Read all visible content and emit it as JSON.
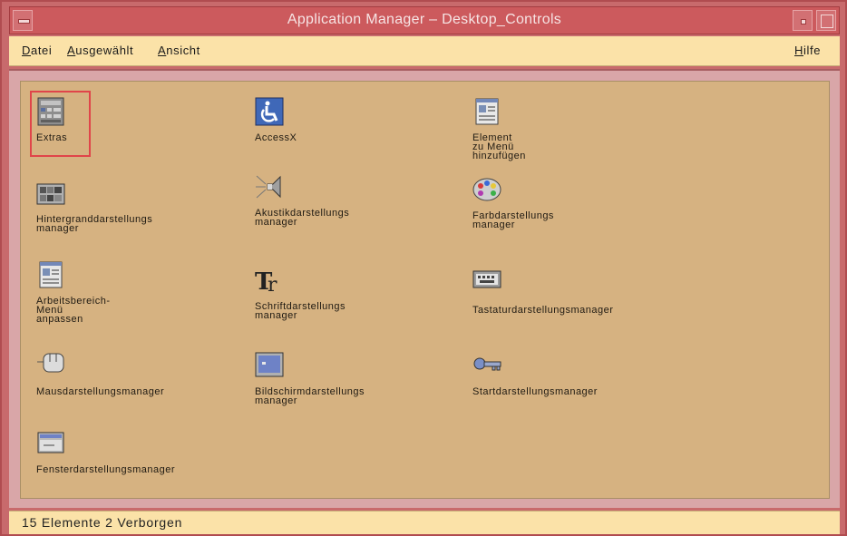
{
  "window": {
    "title": "Application Manager – Desktop_Controls"
  },
  "menubar": {
    "items": [
      {
        "mnemonic": "D",
        "rest": "atei"
      },
      {
        "mnemonic": "A",
        "rest": "usgewählt"
      },
      {
        "mnemonic": "A",
        "rest": "nsicht"
      }
    ],
    "help": {
      "mnemonic": "H",
      "rest": "ilfe"
    }
  },
  "icons": [
    {
      "label": "Extras",
      "icon": "tools-panel-icon",
      "selected": true
    },
    {
      "label": "AccessX",
      "icon": "accessibility-icon"
    },
    {
      "label": "Element zu Menü hinzufügen",
      "icon": "add-menu-item-icon"
    },
    {
      "label": "Hintergranddarstellungs\nmanager",
      "icon": "backdrop-icon"
    },
    {
      "label": "Akustikdarstellungs\nmanager",
      "icon": "speaker-icon"
    },
    {
      "label": "Farbdarstellungs\nmanager",
      "icon": "color-palette-icon"
    },
    {
      "label": "Arbeitsbereich-Menü\nanpassen",
      "icon": "workspace-menu-icon"
    },
    {
      "label": "Schriftdarstellungs\nmanager",
      "icon": "font-icon"
    },
    {
      "label": "Tastaturdarstellungsmanager",
      "icon": "keyboard-icon"
    },
    {
      "label": "Mausdarstellungsmanager",
      "icon": "mouse-icon"
    },
    {
      "label": "Bildschirmdarstellungs\nmanager",
      "icon": "screen-icon"
    },
    {
      "label": "Startdarstellungsmanager",
      "icon": "startup-key-icon"
    },
    {
      "label": "Fensterdarstellungsmanager",
      "icon": "window-icon"
    }
  ],
  "status": {
    "text": "15 Elemente 2 Verborgen"
  },
  "colors": {
    "titlebar": "#cc5a5d",
    "menubar": "#fbe2a8",
    "content": "#d6b281",
    "selection": "#e0454a"
  }
}
